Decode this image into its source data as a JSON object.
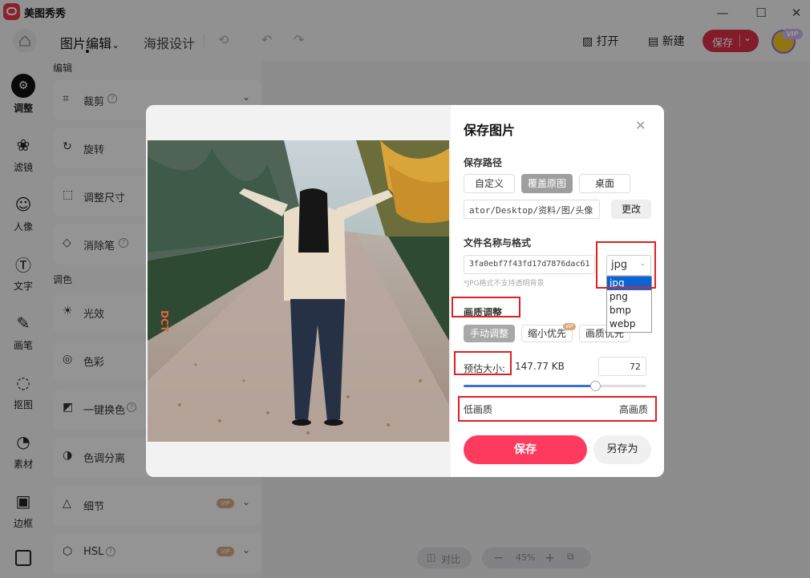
{
  "app": {
    "name": "美图秀秀"
  },
  "window_controls": {
    "minimize": "—",
    "maximize": "☐",
    "close": "✕"
  },
  "toolbar": {
    "tab_edit": "图片编辑",
    "tab_edit_chevron": "⌄",
    "tab_poster": "海报设计",
    "open_label": "打开",
    "new_label": "新建",
    "save_label": "保存",
    "vip_label": "VIP"
  },
  "rail": {
    "items": [
      {
        "label": "调整",
        "icon": "sliders-icon",
        "glyph": "⚙"
      },
      {
        "label": "滤镜",
        "icon": "filter-icon",
        "glyph": "❀"
      },
      {
        "label": "人像",
        "icon": "portrait-icon",
        "glyph": "☺"
      },
      {
        "label": "文字",
        "icon": "text-icon",
        "glyph": "Ⓣ"
      },
      {
        "label": "画笔",
        "icon": "brush-icon",
        "glyph": "✎"
      },
      {
        "label": "抠图",
        "icon": "cutout-icon",
        "glyph": "◌"
      },
      {
        "label": "素材",
        "icon": "sticker-icon",
        "glyph": "◔"
      },
      {
        "label": "边框",
        "icon": "frame-icon",
        "glyph": "▣"
      }
    ]
  },
  "panel": {
    "section_edit": "编辑",
    "section_color": "调色",
    "tools": [
      {
        "label": "裁剪",
        "glyph": "⌗"
      },
      {
        "label": "旋转",
        "glyph": "↻"
      },
      {
        "label": "调整尺寸",
        "glyph": "⬚"
      },
      {
        "label": "消除笔",
        "glyph": "◇"
      },
      {
        "label": "光效",
        "glyph": "☀"
      },
      {
        "label": "色彩",
        "glyph": "◎"
      },
      {
        "label": "一键换色",
        "glyph": "◩"
      },
      {
        "label": "色调分离",
        "glyph": "◑"
      },
      {
        "label": "细节",
        "glyph": "△",
        "vip": "VIP"
      },
      {
        "label": "HSL",
        "glyph": "⬡",
        "vip": "VIP"
      }
    ]
  },
  "canvas": {
    "compare_label": "对比",
    "zoom": "45%"
  },
  "dialog": {
    "title": "保存图片",
    "path_label": "保存路径",
    "path_options": [
      "自定义",
      "覆盖原图",
      "桌面"
    ],
    "path_selected": "覆盖原图",
    "path_value": "ator/Desktop/资料/图/头像",
    "change_label": "更改",
    "name_format_label": "文件名称与格式",
    "filename_value": "3fa0ebf7f43fd17d7876dac61",
    "format_selected": "jpg",
    "format_options": [
      "jpg",
      "png",
      "bmp",
      "webp"
    ],
    "jpg_hint": "*JPG格式不支持透明背景",
    "quality_label": "画质调整",
    "quality_options": [
      "手动调整",
      "缩小优先",
      "画质优先"
    ],
    "quality_selected": "手动调整",
    "vip_small": "VIP",
    "estimate_label": "预估大小:",
    "estimate_value": "147.77 KB",
    "quality_value": "72",
    "quality_slider_percent": 72,
    "low_quality_label": "低画质",
    "high_quality_label": "高画质",
    "save_button": "保存",
    "save_as_button": "另存为",
    "photo_stamp": "DCT"
  },
  "colors": {
    "accent": "#ff3a5f",
    "brand": "#d9304c",
    "annotation": "#e02020",
    "dropdown_highlight": "#0a64d6"
  }
}
